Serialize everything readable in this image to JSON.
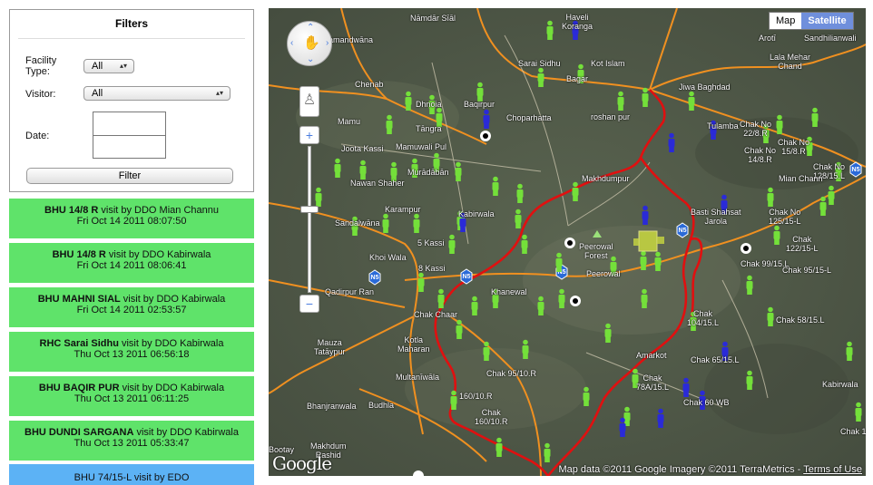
{
  "filters": {
    "title": "Filters",
    "facility_type_label": "Facility Type:",
    "facility_type_value": "All",
    "visitor_label": "Visitor:",
    "visitor_value": "All",
    "date_label": "Date:",
    "filter_button": "Filter"
  },
  "visits": [
    {
      "facility": "BHU 14/8 R",
      "by": " visit by DDO Mian Channu",
      "date": "Fri Oct 14 2011 08:07:50"
    },
    {
      "facility": "BHU 14/8 R",
      "by": " visit by DDO Kabirwala",
      "date": "Fri Oct 14 2011 08:06:41"
    },
    {
      "facility": "BHU MAHNI SIAL",
      "by": " visit by DDO Kabirwala",
      "date": "Fri Oct 14 2011 02:53:57"
    },
    {
      "facility": "RHC Sarai Sidhu",
      "by": " visit by DDO Kabirwala",
      "date": "Thu Oct 13 2011 06:56:18"
    },
    {
      "facility": "BHU BAQIR PUR",
      "by": " visit by DDO Kabirwala",
      "date": "Thu Oct 13 2011 06:11:25"
    },
    {
      "facility": "BHU DUNDI SARGANA",
      "by": " visit by DDO Kabirwala",
      "date": "Thu Oct 13 2011 05:33:47"
    }
  ],
  "visit_partial": "BHU 74/15-L visit by EDO",
  "map": {
    "type_map": "Map",
    "type_satellite": "Satellite",
    "logo": "Google",
    "copyright": "Map data ©2011 Google Imagery ©2011 TerraMetrics - ",
    "terms": "Terms of Use",
    "colors": {
      "green_marker": "#74e03a",
      "blue_marker": "#2a2ad8",
      "border": "#e01010",
      "road": "#f09020"
    },
    "labels": [
      "Nāmdār Sīāl",
      "Haveli Koranga",
      "Chak 755 GB",
      "Arotī",
      "Sandhilianwali",
      "Samandwāna",
      "Sarai Sidhu",
      "Kot Islam",
      "Lala Mehar Chand",
      "Bagar",
      "Jiwa Baghdad",
      "Chenab",
      "Dhnoia",
      "Baqirpur",
      "Choparhatta",
      "roshan pur",
      "Tulamba",
      "Chak No 22/8.R",
      "Mamu",
      "Tāngra",
      "Chak No 15/8.R",
      "Chak No 14/8.R",
      "Joota Kassi",
      "Mamuwali Pul",
      "Murādābān",
      "Chak No 128/15.L",
      "Makhdumpur",
      "Nawan Shaher",
      "Mian Chann",
      "Sandalwāna",
      "Karampur",
      "Kabirwala",
      "Basti Shahsat Jarola",
      "Chak No 125/15-L",
      "Chak 122/15-L",
      "5 Kassi",
      "Peerowal Forest",
      "Peerowal",
      "Khoi Wala",
      "8 Kassi",
      "Chak 99/15.L",
      "Chak 95/15-L",
      "Qadirpur Ran",
      "Khanewal",
      "Chak 104/15.L",
      "Chak 58/15.L",
      "Chak Chaar",
      "Kotla Maharan",
      "Mauza Tatāypur",
      "Amarkot",
      "Chak 65/15.L",
      "Chak 95/10.R",
      "Multanīwāla",
      "Chak 78A/15.L",
      "Kabirwala",
      "160/10.R",
      "Chak 160/10.R",
      "Budhla",
      "Bhanjranwala",
      "Chak 60 WB",
      "Makhdum Rashid",
      "Bootay",
      "Chak 105"
    ]
  }
}
